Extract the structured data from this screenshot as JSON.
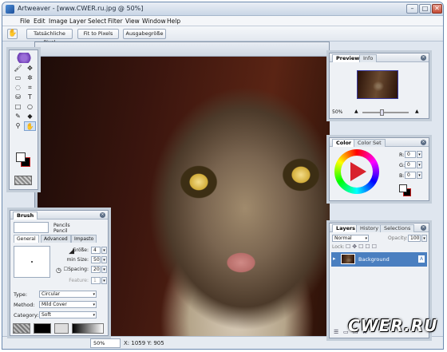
{
  "window": {
    "title": "Artweaver - [www.CWER.ru.jpg @ 50%]",
    "controls": {
      "minimize": "–",
      "maximize": "□",
      "close": "✕"
    }
  },
  "menubar": {
    "items": [
      "File",
      "Edit",
      "Image",
      "Layer",
      "Select",
      "Filter",
      "View",
      "Window",
      "Help"
    ]
  },
  "toolbar": {
    "hand_icon": "hand-icon",
    "buttons": [
      "Tatsächliche Pixel",
      "Fit to Pixels",
      "Ausgabegröße"
    ]
  },
  "tools": [
    {
      "icon": "brush-icon",
      "glyph": "🖌",
      "active": false
    },
    {
      "icon": "move-icon",
      "glyph": "✥",
      "active": false
    },
    {
      "icon": "rect-select-icon",
      "glyph": "▭",
      "active": false
    },
    {
      "icon": "magic-wand-icon",
      "glyph": "✲",
      "active": false
    },
    {
      "icon": "lasso-icon",
      "glyph": "◌",
      "active": false
    },
    {
      "icon": "crop-icon",
      "glyph": "⌗",
      "active": false
    },
    {
      "icon": "rubber-stamp-icon",
      "glyph": "⛁",
      "active": false
    },
    {
      "icon": "text-icon",
      "glyph": "T",
      "active": false
    },
    {
      "icon": "rectangle-icon",
      "glyph": "□",
      "active": false
    },
    {
      "icon": "ellipse-icon",
      "glyph": "○",
      "active": false
    },
    {
      "icon": "eyedropper-icon",
      "glyph": "✎",
      "active": false
    },
    {
      "icon": "fill-bucket-icon",
      "glyph": "◆",
      "active": false
    },
    {
      "icon": "zoom-icon",
      "glyph": "⚲",
      "active": false
    },
    {
      "icon": "hand-icon",
      "glyph": "✋",
      "active": true
    }
  ],
  "brush_panel": {
    "tab": "Brush",
    "category_line1": "Pencils",
    "category_line2": "Pencil",
    "subtabs": [
      "General",
      "Advanced",
      "Impasto"
    ],
    "params": {
      "size_label": "Größe:",
      "size_value": "4",
      "min_size_label": "min Size:",
      "min_size_value": "50",
      "spacing_label": "Spacing:",
      "spacing_value": "20",
      "feature_label": "Feature:",
      "feature_value": "1"
    },
    "type_label": "Type:",
    "type_value": "Circular",
    "method_label": "Method:",
    "method_value": "Mild Cover",
    "category_label": "Category:",
    "category_value": "Soft"
  },
  "preview_panel": {
    "tabs": [
      "Preview",
      "Info"
    ],
    "zoom": "50%"
  },
  "color_panel": {
    "tabs": [
      "Color",
      "Color Set"
    ],
    "r_label": "R:",
    "r_value": "0",
    "g_label": "G:",
    "g_value": "0",
    "b_label": "B:",
    "b_value": "0"
  },
  "layers_panel": {
    "tabs": [
      "Layers",
      "History",
      "Selections"
    ],
    "blend_mode": "Normal",
    "opacity_label": "Opacity:",
    "opacity_value": "100",
    "lock_label": "Lock:",
    "layers": [
      {
        "name": "Background",
        "visible": true
      }
    ]
  },
  "statusbar": {
    "coords": "X: 1059  Y: 905"
  },
  "watermark": "CWER.RU",
  "colors": {
    "accent": "#4a7fc0",
    "foreground": "#ffffff",
    "background": "#000000"
  }
}
